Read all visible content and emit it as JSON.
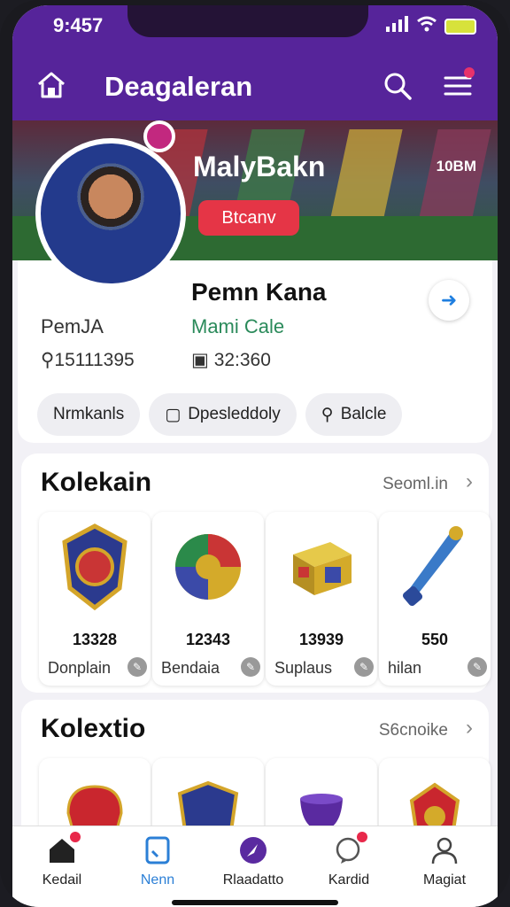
{
  "status": {
    "time": "9:457"
  },
  "nav": {
    "title": "Deagaleran"
  },
  "banner": {
    "name": "MalyBakn",
    "count": "10BM",
    "button": "Btcanv"
  },
  "profile": {
    "name": "Pemn Kana",
    "subtitle": "Mami Cale",
    "username": "PemJA",
    "location": "15111395",
    "stat": "32:360",
    "chips": [
      "Nrmkanls",
      "Dpesleddoly",
      "Balcle"
    ]
  },
  "section1": {
    "title": "Kolekain",
    "link": "Seoml.in",
    "items": [
      {
        "value": "13328",
        "name": "Donplain",
        "icon": "crest-icon"
      },
      {
        "value": "12343",
        "name": "Bendaia",
        "icon": "ball-icon"
      },
      {
        "value": "13939",
        "name": "Suplaus",
        "icon": "box-icon"
      },
      {
        "value": "550",
        "name": "hilan",
        "icon": "torch-icon"
      }
    ]
  },
  "section2": {
    "title": "Kolextio",
    "link": "S6cnoike",
    "items": [
      {
        "icon": "helmet-icon"
      },
      {
        "icon": "shield-icon"
      },
      {
        "icon": "trophy-icon"
      },
      {
        "icon": "badge-icon"
      }
    ]
  },
  "tabs": [
    "Kedail",
    "Nenn",
    "Rlaadatto",
    "Kardid",
    "Magiat"
  ],
  "colors": {
    "brand": "#56249a",
    "accent": "#e53546",
    "active_tab": "#2b7fd6"
  }
}
